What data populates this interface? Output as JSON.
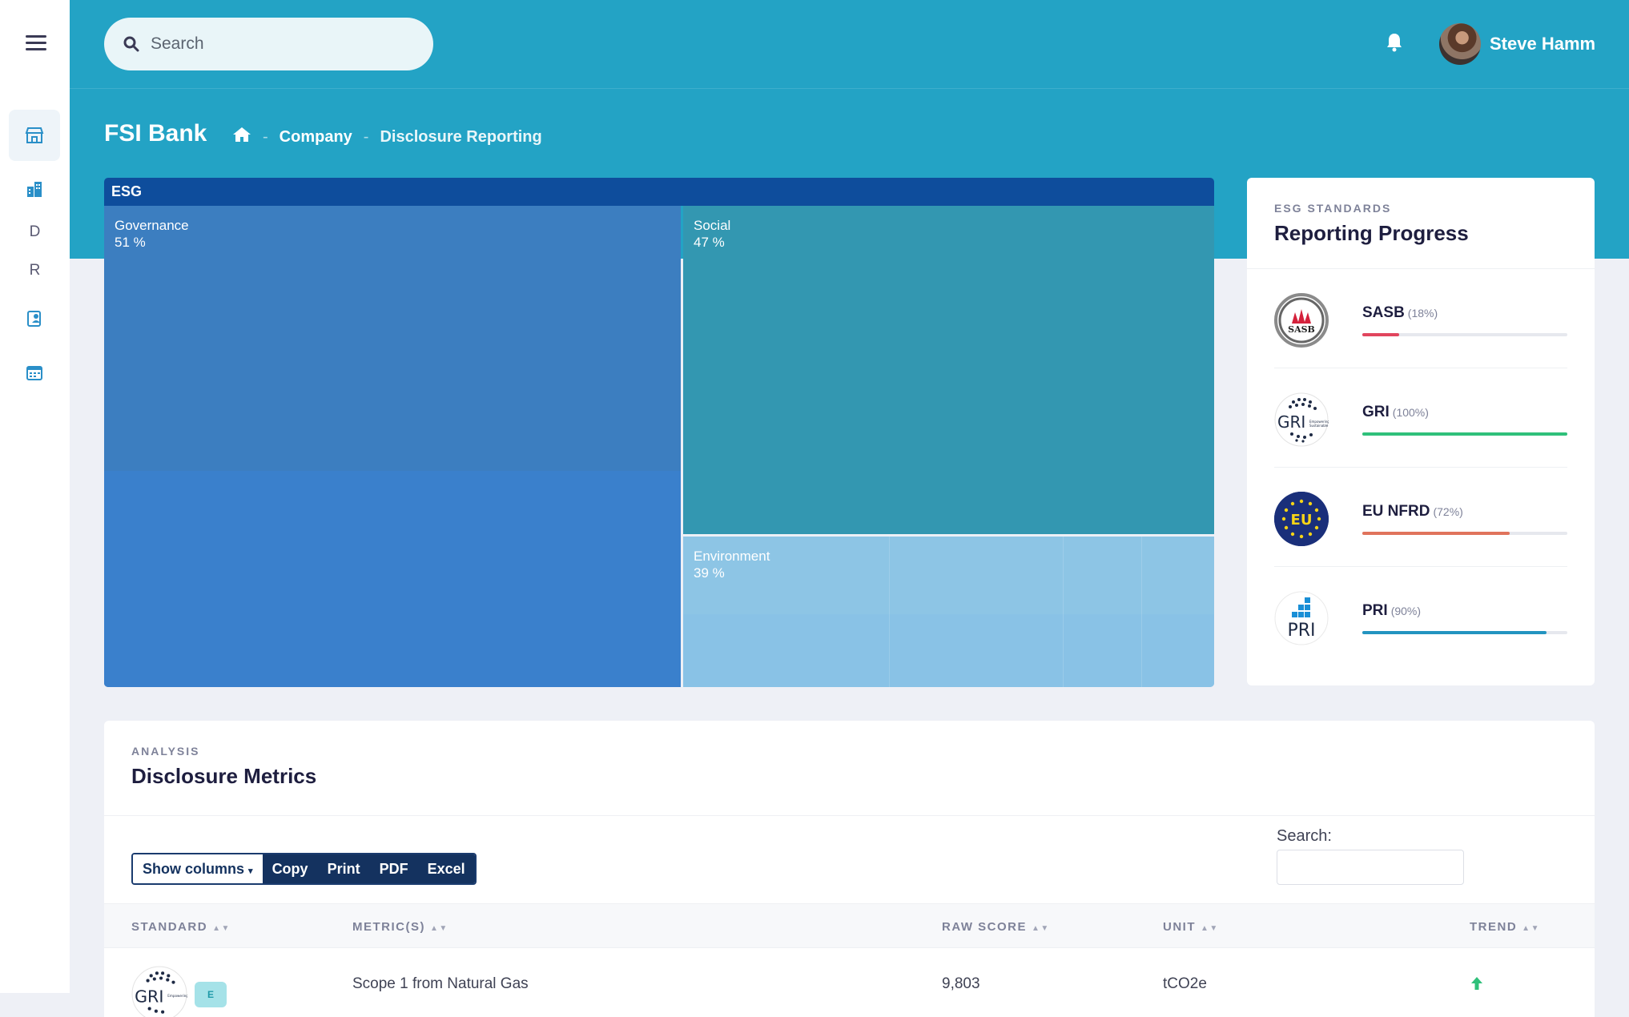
{
  "header": {
    "search_placeholder": "Search",
    "user_name": "Steve Hamm"
  },
  "sidebar": {
    "letters": [
      "D",
      "R"
    ]
  },
  "page": {
    "title": "FSI Bank",
    "breadcrumb": [
      "Company",
      "Disclosure Reporting"
    ]
  },
  "treemap": {
    "root": "ESG",
    "cells": [
      {
        "name": "Governance",
        "value": "51 %",
        "color": "#3c7ec0"
      },
      {
        "name": "Social",
        "value": "47 %",
        "color": "#3397b1"
      },
      {
        "name": "Environment",
        "value": "39 %",
        "color": "#8dc5e5"
      }
    ]
  },
  "standards": {
    "eyebrow": "ESG STANDARDS",
    "title": "Reporting Progress",
    "items": [
      {
        "name": "SASB",
        "pct_label": "(18%)",
        "progress": 0.18,
        "color": "#e1455e",
        "logo": "SASB"
      },
      {
        "name": "GRI",
        "pct_label": "(100%)",
        "progress": 1.0,
        "color": "#2fc07a",
        "logo": "GRI"
      },
      {
        "name": "EU NFRD",
        "pct_label": "(72%)",
        "progress": 0.72,
        "color": "#e0735c",
        "logo": "EU"
      },
      {
        "name": "PRI",
        "pct_label": "(90%)",
        "progress": 0.9,
        "color": "#2394c0",
        "logo": "PRI"
      }
    ]
  },
  "metrics": {
    "eyebrow": "ANALYSIS",
    "title": "Disclosure Metrics",
    "buttons": {
      "show_columns": "Show columns",
      "copy": "Copy",
      "print": "Print",
      "pdf": "PDF",
      "excel": "Excel"
    },
    "search_label": "Search:",
    "columns": [
      "STANDARD",
      "METRIC(S)",
      "RAW SCORE",
      "UNIT",
      "TREND"
    ],
    "rows": [
      {
        "standard_logo": "GRI",
        "badge": "E",
        "metric": "Scope 1 from Natural Gas",
        "raw_score": "9,803",
        "unit": "tCO2e",
        "trend": "up"
      }
    ]
  }
}
